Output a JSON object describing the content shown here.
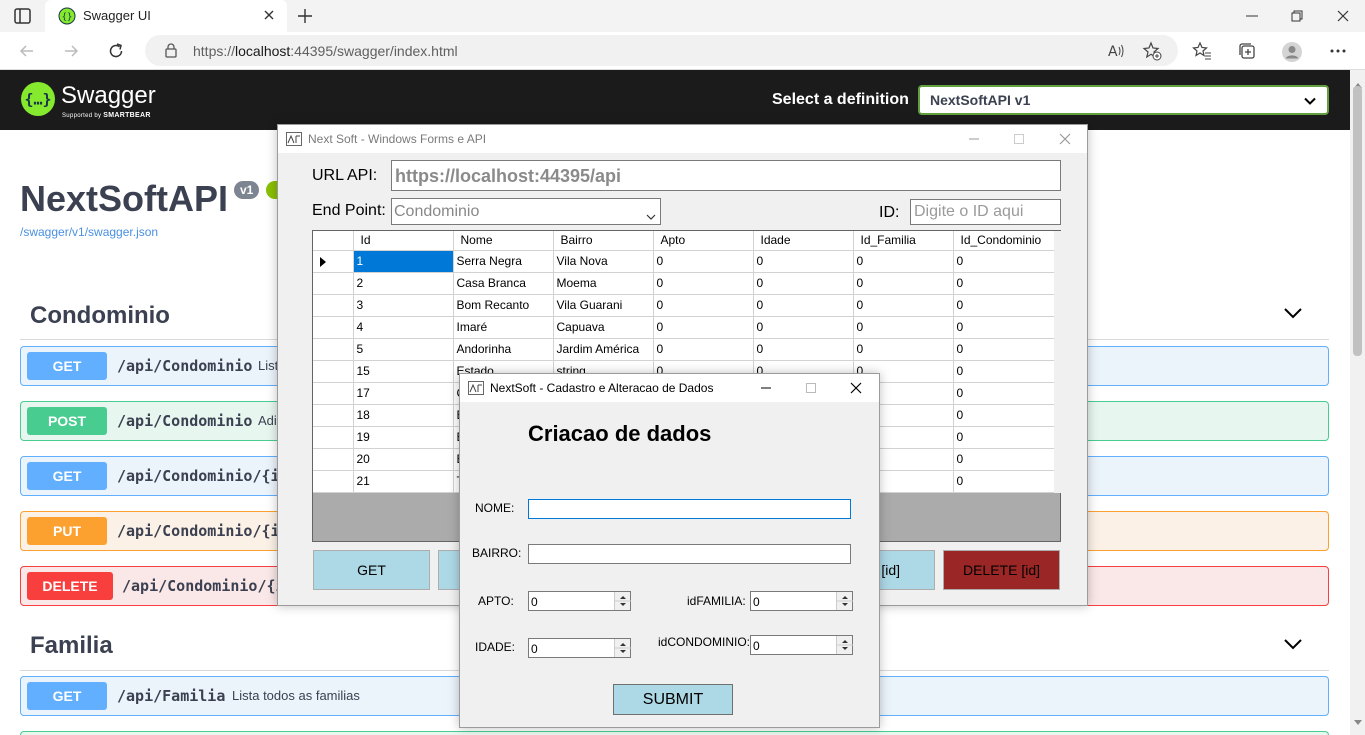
{
  "browser": {
    "tab_title": "Swagger UI",
    "url_prefix": "https://",
    "url_host": "localhost",
    "url_rest": ":44395/swagger/index.html"
  },
  "swagger": {
    "logo_text": "Swagger",
    "logo_sub_prefix": "Supported by",
    "logo_sub_brand": "SMARTBEAR",
    "select_definition_label": "Select a definition",
    "definition_value": "NextSoftAPI v1",
    "api_title": "NextSoftAPI",
    "version": "v1",
    "spec_link": "/swagger/v1/swagger.json",
    "sections": [
      {
        "title": "Condominio",
        "operations": [
          {
            "method": "GET",
            "path": "/api/Condominio",
            "desc": "Lista"
          },
          {
            "method": "POST",
            "path": "/api/Condominio",
            "desc": "Adi"
          },
          {
            "method": "GET",
            "path": "/api/Condominio/{id",
            "desc": ""
          },
          {
            "method": "PUT",
            "path": "/api/Condominio/{id",
            "desc": ""
          },
          {
            "method": "DELETE",
            "path": "/api/Condominio/{i",
            "desc": ""
          }
        ]
      },
      {
        "title": "Familia",
        "operations": [
          {
            "method": "GET",
            "path": "/api/Familia",
            "desc": "Lista todos as familias"
          }
        ]
      }
    ]
  },
  "form_main": {
    "title": "Next Soft - Windows Forms e API",
    "url_api_label": "URL API:",
    "url_api_value": "https://localhost:44395/api",
    "endpoint_label": "End Point:",
    "endpoint_value": "Condominio",
    "id_label": "ID:",
    "id_placeholder": "Digite o ID aqui",
    "grid": {
      "columns": [
        "Id",
        "Nome",
        "Bairro",
        "Apto",
        "Idade",
        "Id_Familia",
        "Id_Condominio"
      ],
      "rows": [
        [
          "1",
          "Serra Negra",
          "Vila Nova",
          "0",
          "0",
          "0",
          "0"
        ],
        [
          "2",
          "Casa Branca",
          "Moema",
          "0",
          "0",
          "0",
          "0"
        ],
        [
          "3",
          "Bom Recanto",
          "Vila Guarani",
          "0",
          "0",
          "0",
          "0"
        ],
        [
          "4",
          "Imaré",
          "Capuava",
          "0",
          "0",
          "0",
          "0"
        ],
        [
          "5",
          "Andorinha",
          "Jardim América",
          "0",
          "0",
          "0",
          "0"
        ],
        [
          "15",
          "Estado",
          "string",
          "0",
          "0",
          "0",
          "0"
        ],
        [
          "17",
          "C",
          "",
          "",
          "",
          "",
          "0"
        ],
        [
          "18",
          "E",
          "",
          "",
          "",
          "",
          "0"
        ],
        [
          "19",
          "E",
          "",
          "",
          "",
          "",
          "0"
        ],
        [
          "20",
          "E",
          "",
          "",
          "",
          "",
          "0"
        ],
        [
          "21",
          "T",
          "",
          "",
          "",
          "",
          "0"
        ]
      ]
    },
    "buttons": {
      "get": "GET",
      "put": "[id]",
      "delete": "DELETE [id]"
    }
  },
  "form_cad": {
    "title": "NextSoft - Cadastro e Alteracao de Dados",
    "heading": "Criacao de dados",
    "nome_label": "NOME:",
    "bairro_label": "BAIRRO:",
    "apto_label": "APTO:",
    "apto_value": "0",
    "idade_label": "IDADE:",
    "idade_value": "0",
    "idfamilia_label": "idFAMILIA:",
    "idfamilia_value": "0",
    "idcondominio_label": "idCONDOMINIO:",
    "idcondominio_value": "0",
    "submit_label": "SUBMIT"
  },
  "colors": {
    "get": "#61affe",
    "post": "#49cc90",
    "put": "#fca130",
    "delete": "#f93e3e",
    "swagger_green": "#85ea2d",
    "form_button_blue": "#add8e6",
    "form_delete_red": "#9b2626",
    "selection_blue": "#0078d7"
  }
}
